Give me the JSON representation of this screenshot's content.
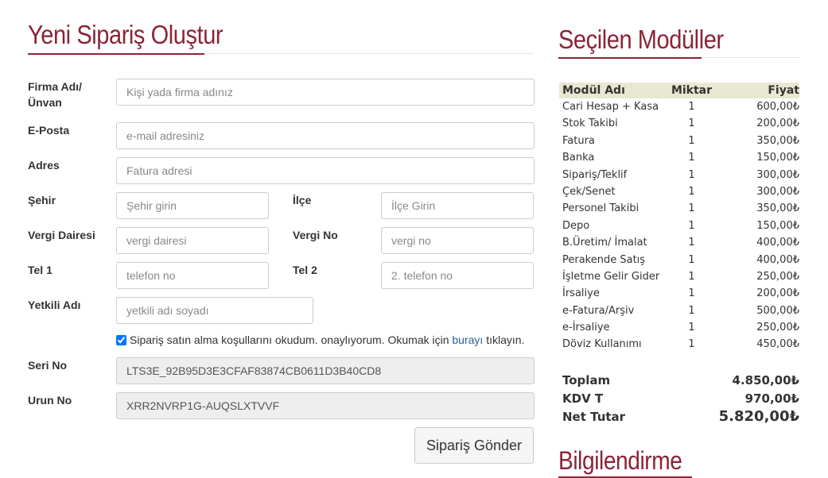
{
  "form": {
    "title": "Yeni Sipariş Oluştur",
    "fields": {
      "firma": {
        "label": "Firma Adı/Ünvan",
        "placeholder": "Kişi yada firma adınız"
      },
      "eposta": {
        "label": "E-Posta",
        "placeholder": "e-mail adresiniz"
      },
      "adres": {
        "label": "Adres",
        "placeholder": "Fatura adresi"
      },
      "sehir": {
        "label": "Şehir",
        "placeholder": "Şehir girin"
      },
      "ilce": {
        "label": "İlçe",
        "placeholder": "İlçe Girin"
      },
      "vergi_dairesi": {
        "label": "Vergi Dairesi",
        "placeholder": "vergi dairesi"
      },
      "vergi_no": {
        "label": "Vergi No",
        "placeholder": "vergi no"
      },
      "tel1": {
        "label": "Tel 1",
        "placeholder": "telefon no"
      },
      "tel2": {
        "label": "Tel 2",
        "placeholder": "2. telefon no"
      },
      "yetkili": {
        "label": "Yetkili Adı",
        "placeholder": "yetkili adı soyadı"
      },
      "seri_no": {
        "label": "Seri No",
        "value": "LTS3E_92B95D3E3CFAF83874CB0611D3B40CD8"
      },
      "urun_no": {
        "label": "Urun No",
        "value": "XRR2NVRP1G-AUQSLXTVVF"
      }
    },
    "agreement": {
      "checked": true,
      "text_before": "Sipariş satın alma koşullarını okudum. onaylıyorum. Okumak için",
      "link": "burayı",
      "text_after": "tıklayın."
    },
    "submit_label": "Sipariş Gönder"
  },
  "modules": {
    "title": "Seçilen Modüller",
    "columns": [
      "Modül Adı",
      "Miktar",
      "Fiyat"
    ],
    "rows": [
      [
        "Cari Hesap + Kasa",
        "1",
        "600,00₺"
      ],
      [
        "Stok Takibi",
        "1",
        "200,00₺"
      ],
      [
        "Fatura",
        "1",
        "350,00₺"
      ],
      [
        "Banka",
        "1",
        "150,00₺"
      ],
      [
        "Sipariş/Teklif",
        "1",
        "300,00₺"
      ],
      [
        "Çek/Senet",
        "1",
        "300,00₺"
      ],
      [
        "Personel Takibi",
        "1",
        "350,00₺"
      ],
      [
        "Depo",
        "1",
        "150,00₺"
      ],
      [
        "B.Üretim/ İmalat",
        "1",
        "400,00₺"
      ],
      [
        "Perakende Satış",
        "1",
        "400,00₺"
      ],
      [
        "İşletme Gelir Gider",
        "1",
        "250,00₺"
      ],
      [
        "İrsaliye",
        "1",
        "200,00₺"
      ],
      [
        "e-Fatura/Arşiv",
        "1",
        "500,00₺"
      ],
      [
        "e-İrsaliye",
        "1",
        "250,00₺"
      ],
      [
        "Döviz Kullanımı",
        "1",
        "450,00₺"
      ]
    ],
    "totals": [
      {
        "label": "Toplam",
        "value": "4.850,00₺"
      },
      {
        "label": "KDV T",
        "value": "970,00₺"
      },
      {
        "label": "Net Tutar",
        "value": "5.820,00₺"
      }
    ]
  },
  "info": {
    "title": "Bilgilendirme"
  },
  "colors": {
    "accent": "#8b2438",
    "table_header": "#e8e7d1",
    "link": "#2a6496"
  }
}
